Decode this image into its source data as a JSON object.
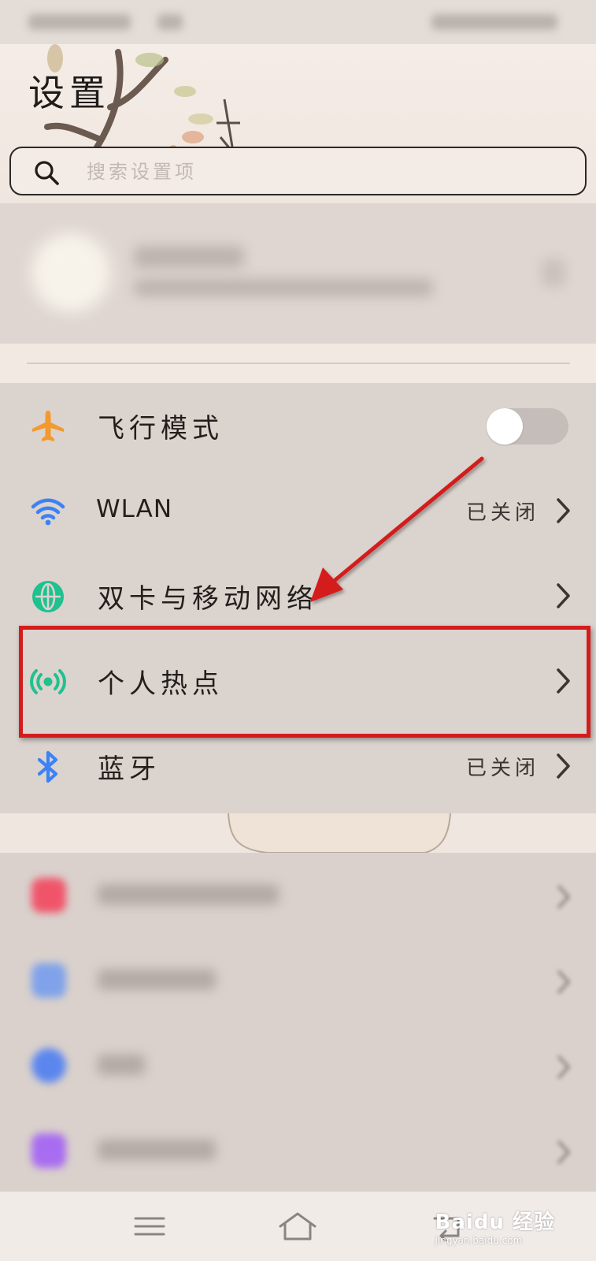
{
  "header": {
    "title": "设置"
  },
  "search": {
    "placeholder": "搜索设置项"
  },
  "settings": {
    "items": [
      {
        "label": "飞行模式",
        "icon": "airplane-icon",
        "toggle_on": false
      },
      {
        "label": "WLAN",
        "icon": "wifi-icon",
        "value": "已关闭"
      },
      {
        "label": "双卡与移动网络",
        "icon": "globe-icon"
      },
      {
        "label": "个人热点",
        "icon": "hotspot-icon"
      },
      {
        "label": "蓝牙",
        "icon": "bluetooth-icon",
        "value": "已关闭"
      }
    ]
  },
  "colors": {
    "highlight": "#d41c1c",
    "airplane": "#f29a2e",
    "wifi": "#3b82f6",
    "globe": "#1fc18f",
    "hotspot": "#1fc18f",
    "bluetooth": "#3b82f6"
  },
  "watermark": {
    "text": "Baidu 经验",
    "subtext": "jingyan.baidu.com"
  }
}
